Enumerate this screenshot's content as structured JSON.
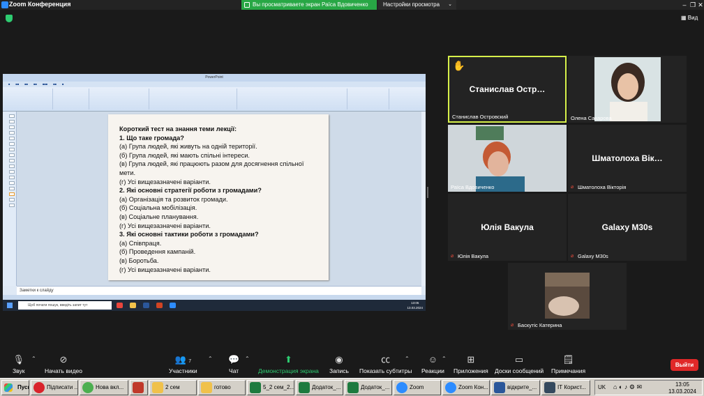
{
  "window": {
    "title": "Zoom Конференция",
    "share_banner": "Вы просматриваете экран Раїса Вдовиченко",
    "view_options": "Настройки просмотра",
    "view_button": "Вид"
  },
  "shared_screen": {
    "notes_placeholder": "Заметки к слайду",
    "search_placeholder": "Щоб почати пошук, введіть запит тут",
    "time": "13:05",
    "date": "13.03.2024",
    "lang": "УКР",
    "slide_lines": [
      {
        "text": "Короткий тест на знання теми лекції:",
        "bold": true
      },
      {
        "text": "1. Що таке громада?",
        "bold": true
      },
      {
        "text": "(а) Група людей, які живуть на одній території.",
        "bold": false
      },
      {
        "text": "(б) Група людей, які мають спільні інтереси.",
        "bold": false
      },
      {
        "text": "(в) Група людей, які працюють разом для досягнення спільної",
        "bold": false
      },
      {
        "text": "мети.",
        "bold": false
      },
      {
        "text": "(г) Усі вищезазначені варіанти.",
        "bold": false
      },
      {
        "text": "2. Які основні стратегії роботи з громадами?",
        "bold": true
      },
      {
        "text": "(а) Організація та розвиток громади.",
        "bold": false
      },
      {
        "text": "(б) Соціальна мобілізація.",
        "bold": false
      },
      {
        "text": "(в) Соціальне планування.",
        "bold": false
      },
      {
        "text": "(г) Усі вищезазначені варіанти.",
        "bold": false
      },
      {
        "text": "3. Які основні тактики роботи з громадами?",
        "bold": true
      },
      {
        "text": "(а) Співпраця.",
        "bold": false
      },
      {
        "text": "(б) Проведення кампаній.",
        "bold": false
      },
      {
        "text": " (в) Боротьба.",
        "bold": false
      },
      {
        "text": "(г) Усі вищезазначені варіанти.",
        "bold": false
      }
    ]
  },
  "participants": [
    {
      "big": "Станислав  Остр…",
      "label": "Станислав Островский",
      "muted": false,
      "video": false,
      "active": true,
      "hand": true
    },
    {
      "big": "",
      "label": "Олена Сахарова",
      "muted": false,
      "video": true
    },
    {
      "big": "",
      "label": "Раїса Вдовиченко",
      "muted": false,
      "video": true
    },
    {
      "big": "Шматолоха  Вік…",
      "label": "Шматолоха Вікторія",
      "muted": true,
      "video": false
    },
    {
      "big": "Юлія Вакула",
      "label": "Юлія Вакула",
      "muted": true,
      "video": false
    },
    {
      "big": "Galaxy M30s",
      "label": "Galaxy M30s",
      "muted": true,
      "video": false
    },
    {
      "big": "",
      "label": "Баскутіс Катерина",
      "muted": true,
      "video": true
    }
  ],
  "toolbar": {
    "audio": "Звук",
    "video": "Начать видео",
    "participants": "Участники",
    "participants_count": "7",
    "chat": "Чат",
    "share": "Демонстрация экрана",
    "record": "Запись",
    "captions": "Показать субтитры",
    "reactions": "Реакции",
    "apps": "Приложения",
    "whiteboards": "Доски сообщений",
    "notes": "Примечания",
    "leave": "Выйти"
  },
  "taskbar": {
    "start": "Пуск",
    "tasks": [
      "Підписати ...",
      "Нова вкл...",
      "",
      "2 сем",
      "готово",
      "5_2 сем_2...",
      "Додаток_...",
      "Додаток_...",
      "Zoom",
      "Zoom Кон...",
      "відкрите_...",
      "ІТ Корист..."
    ],
    "lang": "UK",
    "time": "13:05",
    "date": "13.03.2024"
  },
  "colors": {
    "share_green": "#28a745",
    "active_border": "#d6f04a",
    "leave_red": "#e02828"
  }
}
